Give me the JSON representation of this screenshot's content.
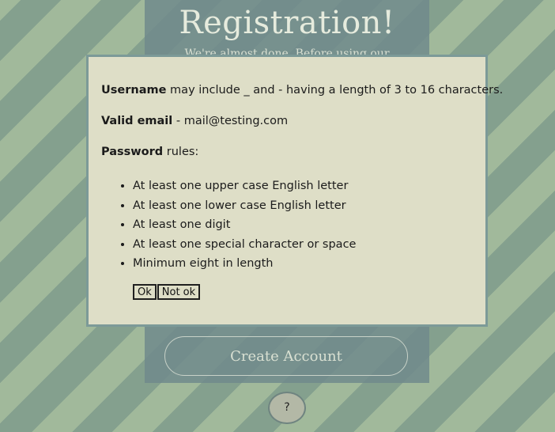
{
  "card": {
    "title": "Registration!",
    "subtitle": "We're almost done. Before using our",
    "create_account_label": "Create Account"
  },
  "help": {
    "label": "?"
  },
  "dialog": {
    "username_label": "Username",
    "username_text": " may include _ and - having a length of 3 to 16 characters.",
    "email_label": "Valid email",
    "email_text": " - mail@testing.com",
    "password_label": "Password",
    "password_text": " rules:",
    "rules": [
      "At least one upper case English letter",
      "At least one lower case English letter",
      "At least one digit",
      "At least one special character or space",
      "Minimum eight in length"
    ],
    "ok_label": "Ok",
    "not_ok_label": "Not ok"
  },
  "colors": {
    "stripe_light": "#a1b99b",
    "stripe_dark": "#84a08e",
    "card_bg": "#708a8c",
    "dialog_bg": "#dedec7",
    "dialog_border": "#7c9a98"
  }
}
